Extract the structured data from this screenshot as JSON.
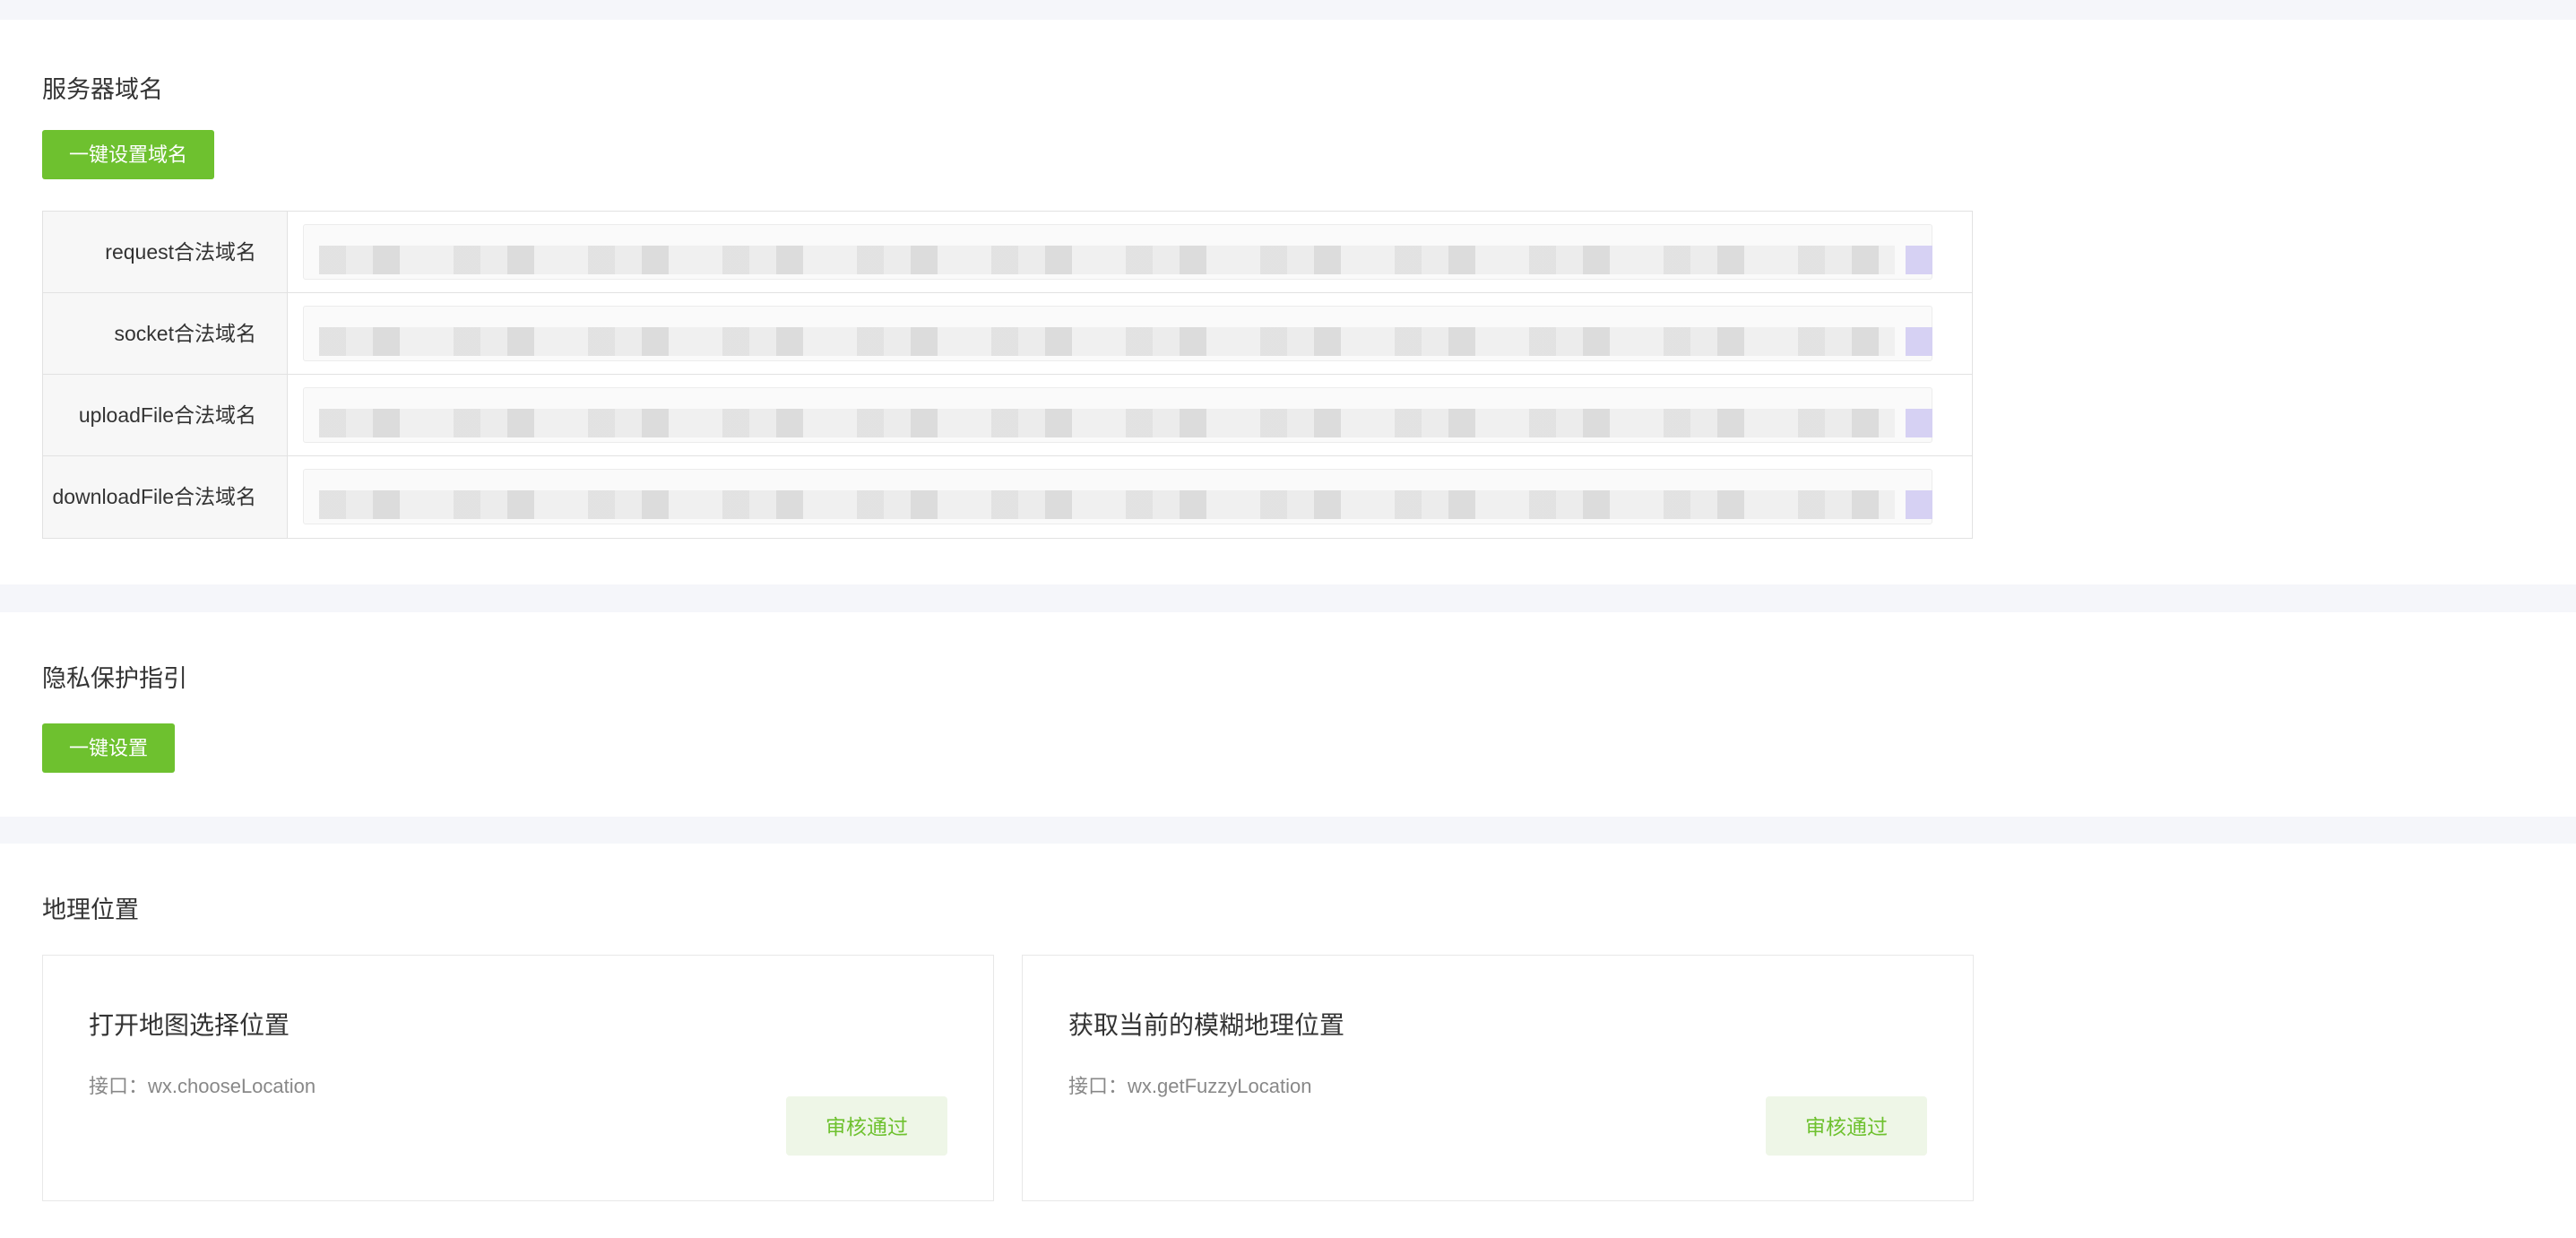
{
  "server_domain": {
    "title": "服务器域名",
    "button_label": "一键设置域名",
    "rows": [
      {
        "label": "request合法域名"
      },
      {
        "label": "socket合法域名"
      },
      {
        "label": "uploadFile合法域名"
      },
      {
        "label": "downloadFile合法域名"
      }
    ]
  },
  "privacy": {
    "title": "隐私保护指引",
    "button_label": "一键设置"
  },
  "location": {
    "title": "地理位置",
    "cards": [
      {
        "title": "打开地图选择位置",
        "api": "接口：wx.chooseLocation",
        "status": "审核通过"
      },
      {
        "title": "获取当前的模糊地理位置",
        "api": "接口：wx.getFuzzyLocation",
        "status": "审核通过"
      }
    ]
  },
  "colors": {
    "accent_green": "#6ec12f",
    "status_bg": "#eef6e7",
    "page_bg": "#f5f6fa"
  }
}
